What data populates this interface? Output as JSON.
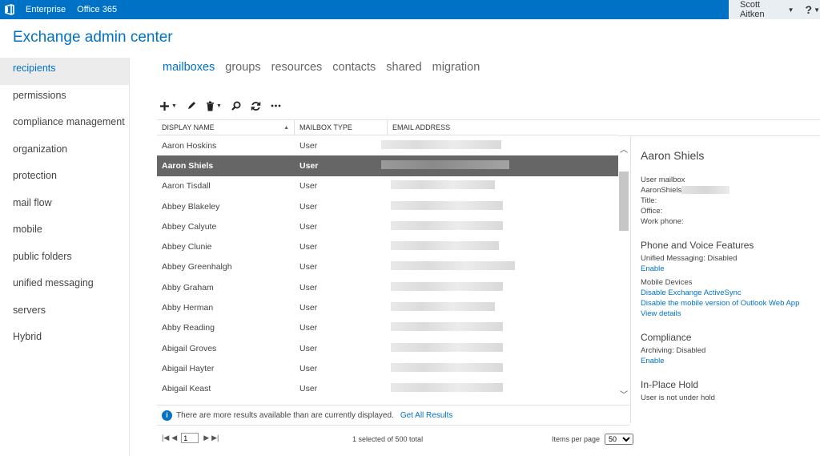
{
  "topbar": {
    "brand": "Enterprise",
    "office": "Office 365",
    "user": "Scott Aitken",
    "help": "?"
  },
  "app_title": "Exchange admin center",
  "nav": [
    {
      "label": "recipients",
      "active": true
    },
    {
      "label": "permissions"
    },
    {
      "label": "compliance management"
    },
    {
      "label": "organization"
    },
    {
      "label": "protection"
    },
    {
      "label": "mail flow"
    },
    {
      "label": "mobile"
    },
    {
      "label": "public folders"
    },
    {
      "label": "unified messaging"
    },
    {
      "label": "servers"
    },
    {
      "label": "Hybrid"
    }
  ],
  "tabs": [
    {
      "label": "mailboxes",
      "active": true
    },
    {
      "label": "groups"
    },
    {
      "label": "resources"
    },
    {
      "label": "contacts"
    },
    {
      "label": "shared"
    },
    {
      "label": "migration"
    }
  ],
  "grid": {
    "headers": {
      "name": "DISPLAY NAME",
      "type": "MAILBOX TYPE",
      "email": "EMAIL ADDRESS"
    },
    "rows": [
      {
        "name": "Aaron Hoskins",
        "type": "User"
      },
      {
        "name": "Aaron Shiels",
        "type": "User",
        "selected": true
      },
      {
        "name": "Aaron Tisdall",
        "type": "User"
      },
      {
        "name": "Abbey Blakeley",
        "type": "User"
      },
      {
        "name": "Abbey Calyute",
        "type": "User"
      },
      {
        "name": "Abbey Clunie",
        "type": "User"
      },
      {
        "name": "Abbey Greenhalgh",
        "type": "User"
      },
      {
        "name": "Abby Graham",
        "type": "User"
      },
      {
        "name": "Abby Herman",
        "type": "User"
      },
      {
        "name": "Abby Reading",
        "type": "User"
      },
      {
        "name": "Abigail Groves",
        "type": "User"
      },
      {
        "name": "Abigail Hayter",
        "type": "User"
      },
      {
        "name": "Abigail Keast",
        "type": "User"
      }
    ]
  },
  "info": {
    "message": "There are more results available than are currently displayed.",
    "link": "Get All Results"
  },
  "pager": {
    "page": "1",
    "selection": "1 selected of 500 total",
    "items_label": "Items per page",
    "items_value": "50"
  },
  "details": {
    "name": "Aaron Shiels",
    "mailbox_type": "User mailbox",
    "alias": "AaronShiels",
    "title": "Title:",
    "office": "Office:",
    "work_phone": "Work phone:",
    "phone_head": "Phone and Voice Features",
    "um_status": "Unified Messaging: Disabled",
    "um_enable": "Enable",
    "mobile_devices": "Mobile Devices",
    "disable_activesync": "Disable Exchange ActiveSync",
    "disable_owa": "Disable the mobile version of Outlook Web App",
    "view_details": "View details",
    "compliance_head": "Compliance",
    "archiving": "Archiving: Disabled",
    "archiving_enable": "Enable",
    "hold_head": "In-Place Hold",
    "hold_status": "User is not under hold"
  }
}
